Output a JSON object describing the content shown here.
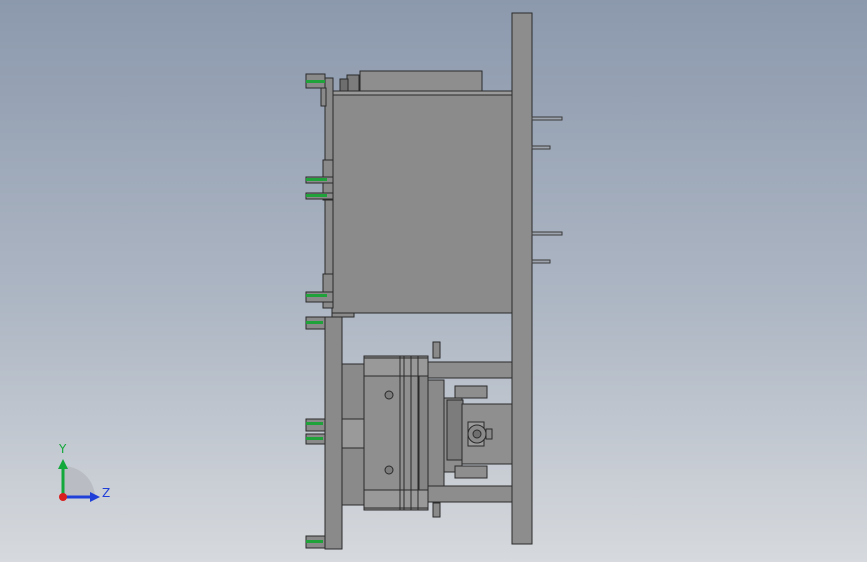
{
  "colors": {
    "part_gray": "#8c8c8c",
    "part_gray_light": "#9a9a9a",
    "part_gray_dark": "#6e6e6e",
    "edge": "#2a2a2a",
    "highlight_green": "#1fa23a",
    "axis_y": "#13a83a",
    "axis_z": "#1f3fd8",
    "axis_x": "#d81e1e"
  },
  "triad": {
    "y_label": "Y",
    "z_label": "Z"
  }
}
